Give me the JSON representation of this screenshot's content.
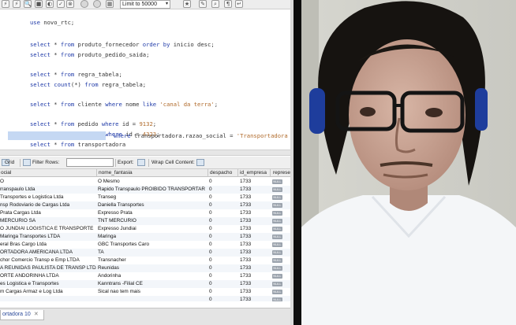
{
  "toolbar": {
    "limit_select": "Limit to 50000 rows"
  },
  "editor": {
    "lines": [
      {
        "kw1": "use",
        "rest": " novo_rtc;"
      },
      {
        "kw1": "select",
        "rest": " * ",
        "kw2": "from",
        "rest2": " produto_fornecedor ",
        "kw3": "order by",
        "rest3": " inicio desc;"
      },
      {
        "kw1": "select",
        "rest": " * ",
        "kw2": "from",
        "rest2": " produto_pedido_saida;"
      },
      {
        "kw1": "select",
        "rest": " * ",
        "kw2": "from",
        "rest2": " regra_tabela;"
      },
      {
        "kw1": "select",
        "rest": " ",
        "kw2": "count",
        "rest2": "(*) ",
        "kw3": "from",
        "rest3": " regra_tabela;"
      },
      {
        "kw1": "select",
        "rest": " * ",
        "kw2": "from",
        "rest2": " cliente ",
        "kw3": "where",
        "rest3": " nome ",
        "kw4": "like",
        "str": " 'canal da terra'",
        "end": ";"
      },
      {
        "kw1": "select",
        "rest": " * ",
        "kw2": "from",
        "rest2": " pedido ",
        "kw3": "where",
        "rest3": " id = ",
        "num": "9132",
        "end": ";"
      },
      {
        "kw1": "select",
        "rest": " * ",
        "kw2": "from",
        "rest2": " usuario ",
        "kw3": "where",
        "rest3": " id = ",
        "num": "4323",
        "end": ";"
      },
      {
        "kw1": "select",
        "rest": " * ",
        "kw2": "from",
        "rest2": " transportadora",
        "tail_kw": "where",
        "tail": " transportadora.razao_social = ",
        "tail_str": "'Transportadora Penh"
      }
    ]
  },
  "grid_toolbar": {
    "grid_label": "Grid",
    "filter_label": "Filter Rows:",
    "export_label": "Export:",
    "wrap_label": "Wrap Cell Content:"
  },
  "grid": {
    "columns": [
      "ocial",
      "nome_fantasia",
      "despacho",
      "id_empresa",
      "represe"
    ],
    "null_label": "NULL",
    "rows": [
      [
        "O",
        "O Mesmo",
        "0",
        "1733"
      ],
      [
        "rranspaulo Ltda",
        "Rapido Transpaulo PROIBIDO TRANSPORTAR",
        "0",
        "1733"
      ],
      [
        "Transportes e Logistica Ltda",
        "Transeg",
        "0",
        "1733"
      ],
      [
        "nsp Rodoviario de Cargas Ltda",
        "Daniella Transportes",
        "0",
        "1733"
      ],
      [
        "Prata Cargas Ltda",
        "Expresso Prata",
        "0",
        "1733"
      ],
      [
        "MERCURIO SA",
        "TNT MERCURIO",
        "0",
        "1733"
      ],
      [
        "O JUNDIAI LOGISTICA E TRANSPORTE",
        "Expresso Jundiai",
        "0",
        "1733"
      ],
      [
        "Maringa Transportes LTDA",
        "Maringa",
        "0",
        "1733"
      ],
      [
        "eral Bras Cargo Ltda",
        "GBC Transportes     Caro",
        "0",
        "1733"
      ],
      [
        "ORTADORA AMERICANA LTDA",
        "TA",
        "0",
        "1733"
      ],
      [
        "chor Comercio Transp e Emp LTDA",
        "Transnacher",
        "0",
        "1733"
      ],
      [
        "A REUNIDAS PAULISTA DE TRANSP LTDA",
        "Reunidas",
        "0",
        "1733"
      ],
      [
        "ORTE ANDORINHA LTDA",
        "Andorinha",
        "0",
        "1733"
      ],
      [
        "es Logistica e Transportes",
        "Kanntrans -Filial CE",
        "0",
        "1733"
      ],
      [
        "m Cargas Armaz e Log Ltda",
        "Sical nao tem mais",
        "0",
        "1733"
      ],
      [
        "",
        "",
        "0",
        "1733"
      ]
    ]
  },
  "tabs": {
    "result_tab": "ortadora 10"
  },
  "colors": {
    "keyword": "#1f3aa8",
    "string": "#b06a2a",
    "selection": "#c5d8f3",
    "divider": "#0e0e0e"
  }
}
